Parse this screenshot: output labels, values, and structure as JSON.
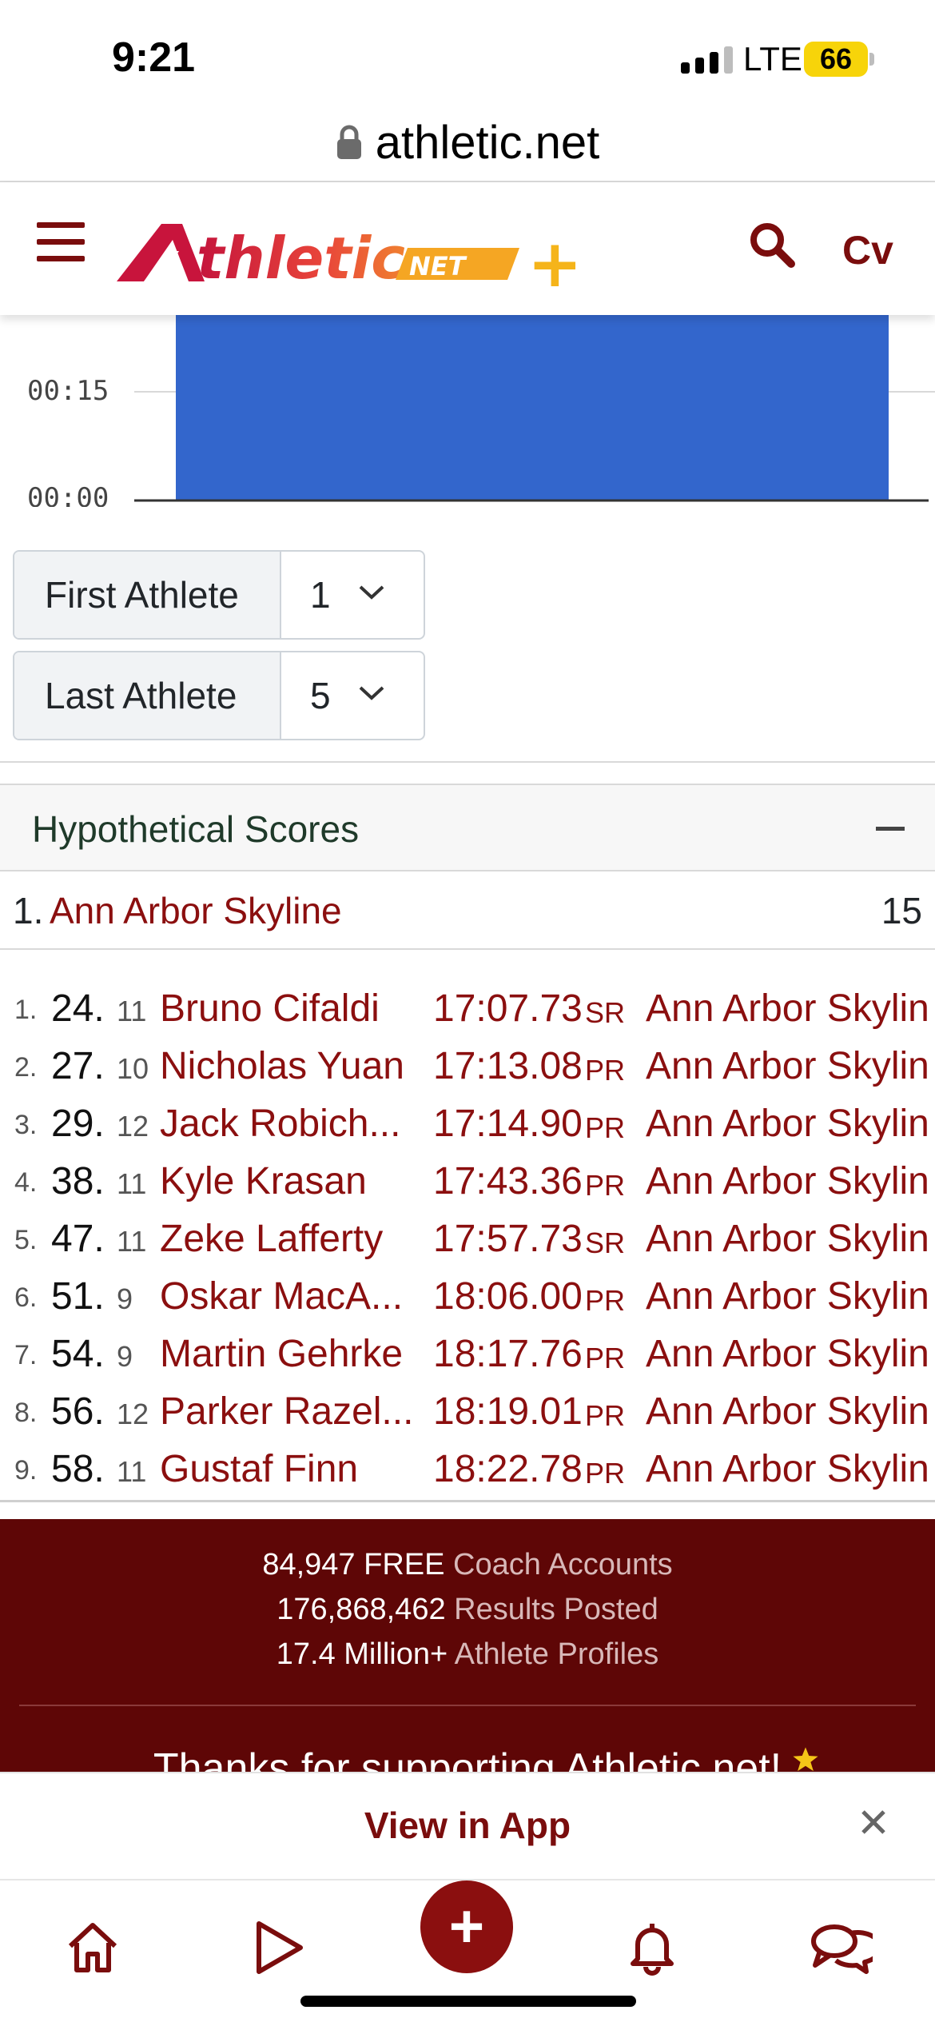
{
  "status_bar": {
    "time": "9:21",
    "network": "LTE",
    "battery": "66"
  },
  "browser": {
    "url": "athletic.net"
  },
  "header": {
    "logo_alt": "Athletic NET +",
    "logo_main": "thletic",
    "logo_net": "NET",
    "logo_plus": "+",
    "user_initials": "Cv"
  },
  "chart": {
    "y_ticks": [
      "00:15",
      "00:00"
    ]
  },
  "chart_data": {
    "type": "bar",
    "categories": [
      ""
    ],
    "values": [
      null
    ],
    "ylabel": "",
    "yticks": [
      "00:00",
      "00:15"
    ],
    "bar_color": "#3366cc"
  },
  "filters": {
    "first": {
      "label": "First Athlete",
      "value": "1"
    },
    "last": {
      "label": "Last Athlete",
      "value": "5"
    }
  },
  "scores_card": {
    "title": "Hypothetical Scores",
    "team": {
      "rank": "1.",
      "name": "Ann Arbor Skyline",
      "score": "15"
    },
    "results": [
      {
        "idx": "1.",
        "place": "24.",
        "grade": "11",
        "name": "Bruno Cifaldi",
        "time": "17:07.73",
        "tag": "SR",
        "team": "Ann Arbor Skylin"
      },
      {
        "idx": "2.",
        "place": "27.",
        "grade": "10",
        "name": "Nicholas Yuan",
        "time": "17:13.08",
        "tag": "PR",
        "team": "Ann Arbor Skylin"
      },
      {
        "idx": "3.",
        "place": "29.",
        "grade": "12",
        "name": "Jack Robich...",
        "time": "17:14.90",
        "tag": "PR",
        "team": "Ann Arbor Skylin"
      },
      {
        "idx": "4.",
        "place": "38.",
        "grade": "11",
        "name": "Kyle Krasan",
        "time": "17:43.36",
        "tag": "PR",
        "team": "Ann Arbor Skylin"
      },
      {
        "idx": "5.",
        "place": "47.",
        "grade": "11",
        "name": "Zeke Lafferty",
        "time": "17:57.73",
        "tag": "SR",
        "team": "Ann Arbor Skylin"
      },
      {
        "idx": "6.",
        "place": "51.",
        "grade": "9",
        "name": "Oskar MacA...",
        "time": "18:06.00",
        "tag": "PR",
        "team": "Ann Arbor Skylin"
      },
      {
        "idx": "7.",
        "place": "54.",
        "grade": "9",
        "name": "Martin Gehrke",
        "time": "18:17.76",
        "tag": "PR",
        "team": "Ann Arbor Skylin"
      },
      {
        "idx": "8.",
        "place": "56.",
        "grade": "12",
        "name": "Parker Razel...",
        "time": "18:19.01",
        "tag": "PR",
        "team": "Ann Arbor Skylin"
      },
      {
        "idx": "9.",
        "place": "58.",
        "grade": "11",
        "name": "Gustaf Finn",
        "time": "18:22.78",
        "tag": "PR",
        "team": "Ann Arbor Skylin"
      }
    ]
  },
  "footer": {
    "stat1_num": "84,947 FREE",
    "stat1_label": "Coach Accounts",
    "stat2_num": "176,868,462",
    "stat2_label": "Results Posted",
    "stat3_num": "17.4 Million+",
    "stat3_label": "Athlete Profiles",
    "thanks": "Thanks for supporting Athletic.net!"
  },
  "app_banner": {
    "label": "View in App"
  },
  "bottom_nav": {
    "add_label": "+"
  }
}
